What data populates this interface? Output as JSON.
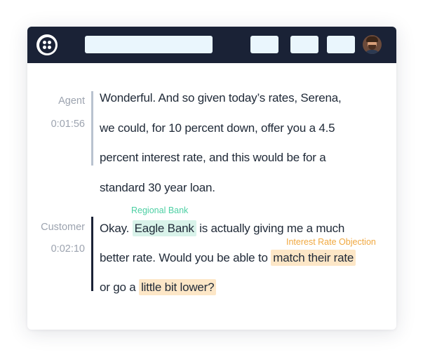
{
  "colors": {
    "topbar_bg": "#1a2236",
    "agent_bar": "#b9c2cf",
    "customer_bar": "#1a2236",
    "entity_highlight": "#d9f3ea",
    "entity_label": "#4ccfa3",
    "objection_highlight": "#fde7c7",
    "objection_label": "#f0a840"
  },
  "header": {
    "logo_icon": "twilio-logo-icon",
    "avatar_icon": "user-avatar"
  },
  "transcript": {
    "agent": {
      "role": "Agent",
      "time": "0:01:56",
      "lines": [
        "Wonderful.  And so given today’s rates, Serena,",
        "we could, for 10 percent down, offer you a 4.5",
        "percent interest rate, and this would be for a",
        "standard 30 year loan."
      ]
    },
    "customer": {
      "role": "Customer",
      "time": "0:02:10",
      "line1": {
        "pre": "Okay. ",
        "entity": "Eagle Bank",
        "post": " is actually giving me a much"
      },
      "line2": {
        "pre": "better rate. Would  you be able to ",
        "objection": "match their rate"
      },
      "line3": {
        "pre": "or go a ",
        "objection": "little bit lower?"
      },
      "entity_label": "Regional Bank",
      "objection_label": "Interest Rate Objection"
    }
  }
}
